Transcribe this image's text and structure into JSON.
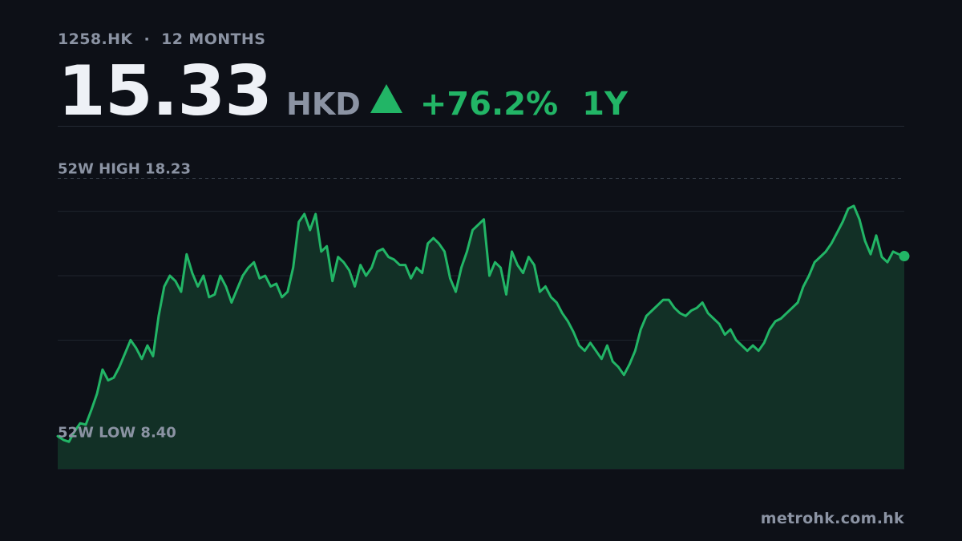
{
  "header": {
    "ticker": "1258.HK",
    "separator": "·",
    "range_label": "12 MONTHS"
  },
  "quote": {
    "price": "15.33",
    "currency": "HKD",
    "change": "+76.2%",
    "period": "1Y"
  },
  "colors": {
    "background": "#0d1017",
    "accent_up": "#22b566",
    "muted_text": "#8b93a3"
  },
  "icons": {
    "direction": "triangle-up-icon"
  },
  "footer": {
    "source": "metrohk.com.hk"
  },
  "chart_data": {
    "type": "area",
    "title": "",
    "xlabel": "",
    "ylabel": "",
    "ylim": [
      7.4,
      19.2
    ],
    "grid": true,
    "grid_values": [
      17.0,
      14.6,
      12.2
    ],
    "reference_lines": [
      {
        "label": "52W HIGH",
        "value": "18.23",
        "y": 18.23
      },
      {
        "label": "52W LOW",
        "value": "8.40",
        "y": 8.4
      }
    ],
    "series": [
      {
        "values": [
          8.62,
          8.48,
          8.41,
          8.8,
          9.1,
          9.05,
          9.6,
          10.2,
          11.1,
          10.7,
          10.8,
          11.2,
          11.7,
          12.2,
          11.9,
          11.5,
          12.0,
          11.6,
          13.1,
          14.2,
          14.6,
          14.4,
          14.0,
          15.4,
          14.7,
          14.2,
          14.6,
          13.8,
          13.9,
          14.6,
          14.2,
          13.6,
          14.1,
          14.6,
          14.9,
          15.1,
          14.5,
          14.6,
          14.2,
          14.3,
          13.8,
          14.0,
          14.9,
          16.6,
          16.9,
          16.3,
          16.9,
          15.5,
          15.7,
          14.4,
          15.3,
          15.1,
          14.8,
          14.2,
          15.0,
          14.6,
          14.9,
          15.5,
          15.6,
          15.3,
          15.2,
          15.0,
          15.0,
          14.5,
          14.9,
          14.7,
          15.8,
          16.0,
          15.8,
          15.5,
          14.5,
          14.0,
          14.9,
          15.5,
          16.3,
          16.5,
          16.7,
          14.6,
          15.1,
          14.9,
          13.9,
          15.5,
          15.0,
          14.7,
          15.3,
          15.0,
          14.0,
          14.2,
          13.8,
          13.6,
          13.2,
          12.9,
          12.5,
          12.0,
          11.8,
          12.1,
          11.8,
          11.5,
          12.0,
          11.4,
          11.2,
          10.9,
          11.3,
          11.8,
          12.6,
          13.1,
          13.3,
          13.5,
          13.7,
          13.7,
          13.4,
          13.2,
          13.1,
          13.3,
          13.4,
          13.6,
          13.2,
          13.0,
          12.8,
          12.4,
          12.6,
          12.2,
          12.0,
          11.8,
          12.0,
          11.8,
          12.1,
          12.6,
          12.9,
          13.0,
          13.2,
          13.4,
          13.6,
          14.2,
          14.6,
          15.1,
          15.3,
          15.5,
          15.8,
          16.2,
          16.6,
          17.1,
          17.2,
          16.7,
          15.9,
          15.4,
          16.1,
          15.3,
          15.1,
          15.5,
          15.4,
          15.33
        ]
      }
    ]
  }
}
